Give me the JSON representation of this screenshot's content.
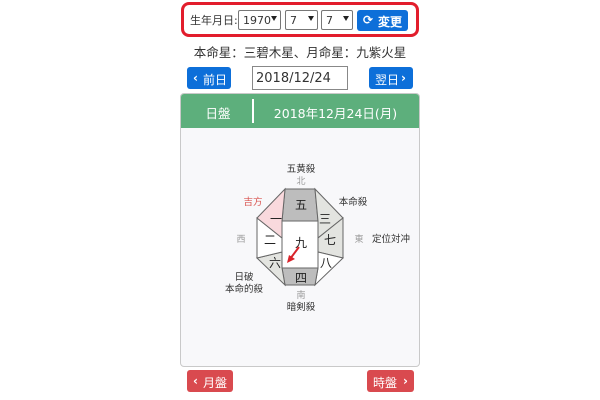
{
  "birth": {
    "label": "生年月日:",
    "year": "1970",
    "month": "7",
    "day": "7",
    "change_icon": "refresh-icon",
    "change_label": "変更"
  },
  "honmei_text": "本命星：三碧木星、月命星：九紫火星",
  "nav": {
    "prev_label": "前日",
    "date_value": "2018/12/24",
    "next_label": "翌日"
  },
  "card": {
    "tab_label": "日盤",
    "date_title": "2018年12月24日(月)"
  },
  "board": {
    "center": "九",
    "cells": {
      "n": "五",
      "ne": "三",
      "e": "七",
      "se": "八",
      "s": "四",
      "sw": "六",
      "w": "二",
      "nw": "一"
    },
    "directions": {
      "north": "北",
      "south": "南",
      "east": "東",
      "west": "西"
    },
    "notes": {
      "n": "五黄殺",
      "ne": "本命殺",
      "e": "定位対冲",
      "s": "暗剣殺",
      "sw_1": "日破",
      "sw_2": "本命的殺",
      "nw": "吉方"
    },
    "colors": {
      "gray_cell": "#bdbdbd",
      "light_cell": "#e3e4e0",
      "lucky_cell": "#f9d9dd",
      "lucky_text": "#d9534f",
      "arrow": "#d9232a"
    }
  },
  "footer": {
    "prev_label": "月盤",
    "next_label": "時盤"
  }
}
